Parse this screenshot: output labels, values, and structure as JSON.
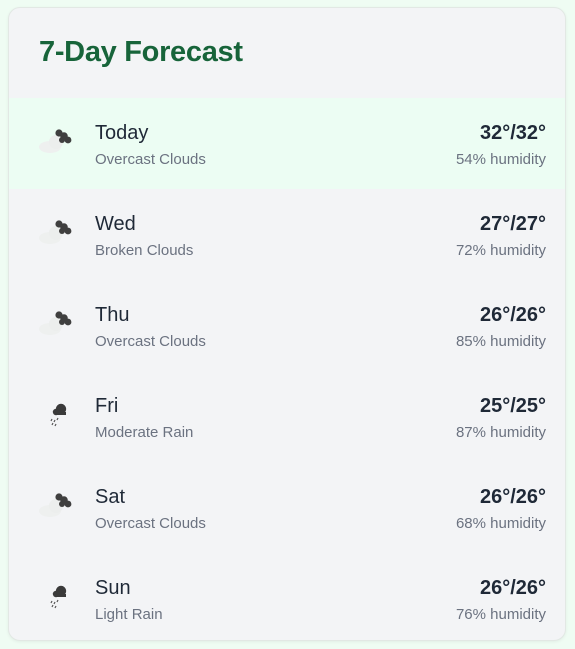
{
  "forecast": {
    "title": "7-Day Forecast",
    "days": [
      {
        "day": "Today",
        "description": "Overcast Clouds",
        "temp": "32°/32°",
        "humidity": "54% humidity",
        "icon": "cloud-icon",
        "active": true
      },
      {
        "day": "Wed",
        "description": "Broken Clouds",
        "temp": "27°/27°",
        "humidity": "72% humidity",
        "icon": "cloud-icon",
        "active": false
      },
      {
        "day": "Thu",
        "description": "Overcast Clouds",
        "temp": "26°/26°",
        "humidity": "85% humidity",
        "icon": "cloud-icon",
        "active": false
      },
      {
        "day": "Fri",
        "description": "Moderate Rain",
        "temp": "25°/25°",
        "humidity": "87% humidity",
        "icon": "rain-icon",
        "active": false
      },
      {
        "day": "Sat",
        "description": "Overcast Clouds",
        "temp": "26°/26°",
        "humidity": "68% humidity",
        "icon": "cloud-icon",
        "active": false
      },
      {
        "day": "Sun",
        "description": "Light Rain",
        "temp": "26°/26°",
        "humidity": "76% humidity",
        "icon": "rain-icon",
        "active": false
      }
    ]
  },
  "colors": {
    "title": "#17643a",
    "active_row": "#ecfdf3",
    "card": "#f3f4f6",
    "page": "#effcf3"
  }
}
